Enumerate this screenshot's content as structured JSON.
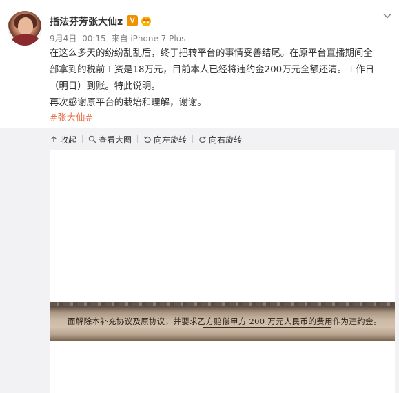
{
  "post": {
    "username": "指法芬芳张大仙z",
    "verified_badge": "V",
    "meta": {
      "date": "9月4日",
      "time": "00:15",
      "source": "来自 iPhone 7 Plus"
    },
    "content_lines": [
      "在这么多天的纷纷乱乱后，终于把转平台的事情妥善结尾。在原平台直播期间全",
      "部拿到的税前工资是18万元，目前本人已经将违约金200万元全额还清。工作日",
      "（明日）到账。特此说明。",
      "再次感谢原平台的栽培和理解，谢谢。"
    ],
    "hashtag": "#张大仙#",
    "icons": {
      "avatar": "user-avatar",
      "menu": "chevron-down-icon",
      "vip": "vip-crown-icon"
    }
  },
  "toolbar": {
    "collapse_label": "收起",
    "view_large_label": "查看大图",
    "rotate_left_label": "向左旋转",
    "rotate_right_label": "向右旋转",
    "icons": [
      "collapse-up-icon",
      "search-icon",
      "rotate-left-icon",
      "rotate-right-icon"
    ]
  },
  "photo": {
    "document_text": "面解除本补充协议及原协议，并要求乙方赔偿甲方 200 万元人民币的费用作为违约金。"
  },
  "colors": {
    "accent": "#eb7350",
    "badge": "#f29100",
    "meta": "#808080",
    "text": "#333333"
  }
}
